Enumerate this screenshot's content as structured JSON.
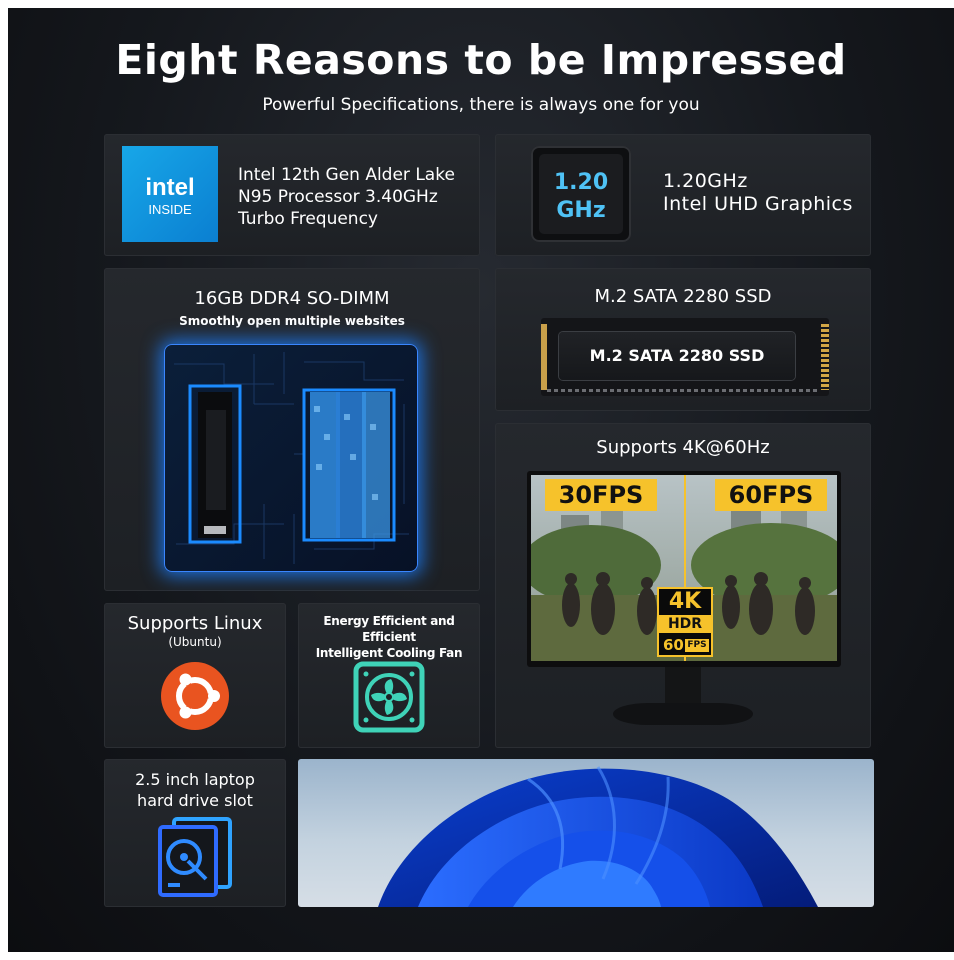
{
  "header": {
    "title": "Eight Reasons to be Impressed",
    "subtitle": "Powerful Specifications, there is always one for you"
  },
  "cpu": {
    "logo_word": "intel",
    "logo_sub": "INSIDE",
    "lines": [
      "Intel 12th Gen Alder Lake",
      "N95 Processor 3.40GHz",
      "Turbo Frequency"
    ]
  },
  "gpu": {
    "chip_line1": "1.20",
    "chip_line2": "GHz",
    "lines": [
      "1.20GHz",
      "Intel UHD Graphics"
    ]
  },
  "memory": {
    "title": "16GB DDR4 SO-DIMM",
    "subtitle": "Smoothly open multiple websites"
  },
  "ssd": {
    "title": "M.2 SATA 2280 SSD",
    "label": "M.2 SATA 2280 SSD"
  },
  "display": {
    "title": "Supports 4K@60Hz",
    "left_fps": "30FPS",
    "right_fps": "60FPS",
    "badge_4k": "4K",
    "badge_hdr": "HDR",
    "badge_fps": "60",
    "badge_fps_unit": "FPS"
  },
  "linux": {
    "title": "Supports Linux",
    "subtitle": "(Ubuntu)"
  },
  "cooling": {
    "lines": [
      "Energy Efficient and Efficient",
      "Intelligent Cooling Fan"
    ]
  },
  "hdd": {
    "lines": [
      "2.5 inch laptop",
      "hard drive slot"
    ]
  },
  "colors": {
    "accent_blue": "#1d6fd8",
    "fps_yellow": "#f6c22b",
    "ubuntu_orange": "#e95420",
    "fan_green": "#3fd3b8"
  },
  "icons": [
    "intel-logo",
    "chip-icon",
    "ubuntu-icon",
    "fan-icon",
    "hard-drive-icon"
  ]
}
